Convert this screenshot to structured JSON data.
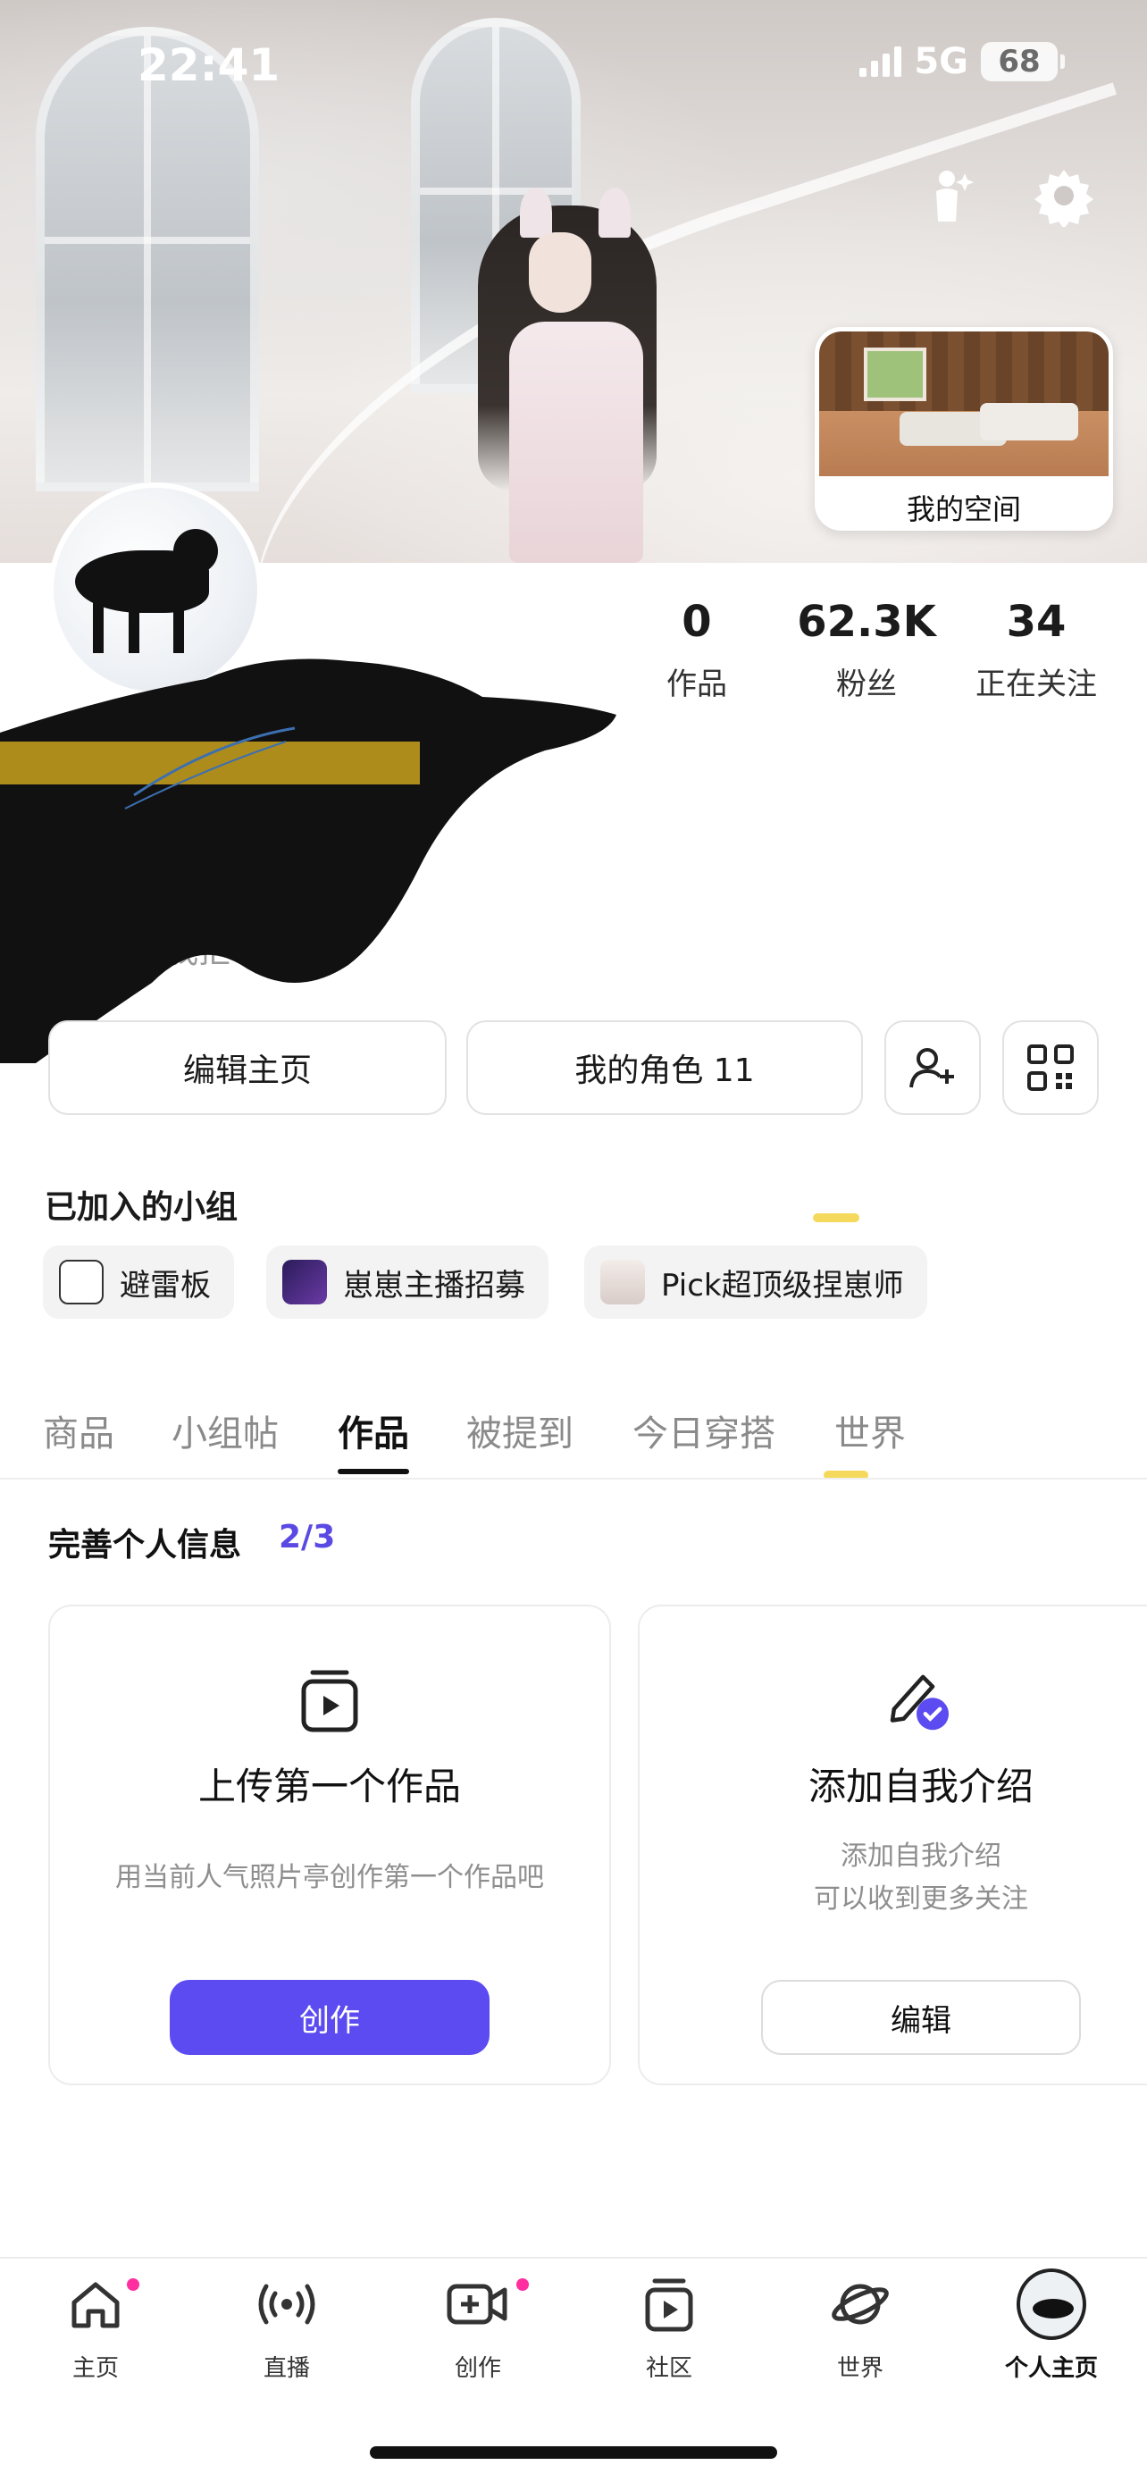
{
  "status_bar": {
    "time": "22:41",
    "network": "5G",
    "battery": "68"
  },
  "header": {
    "my_space_label": "我的空间"
  },
  "stats": [
    {
      "value": "0",
      "label": "作品"
    },
    {
      "value": "62.3K",
      "label": "粉丝"
    },
    {
      "value": "34",
      "label": "正在关注"
    }
  ],
  "bio_fragment": "我拒",
  "actions": {
    "edit_profile": "编辑主页",
    "my_characters": "我的角色 11"
  },
  "groups": {
    "title": "已加入的小组",
    "items": [
      {
        "name": "避雷板"
      },
      {
        "name": "崽崽主播招募"
      },
      {
        "name": "Pick超顶级捏崽师"
      }
    ]
  },
  "tabs": [
    {
      "label": "商品"
    },
    {
      "label": "小组帖"
    },
    {
      "label": "作品"
    },
    {
      "label": "被提到"
    },
    {
      "label": "今日穿搭"
    },
    {
      "label": "世界"
    }
  ],
  "active_tab": "作品",
  "complete_profile": {
    "title": "完善个人信息",
    "progress": "2/3",
    "cards": [
      {
        "icon": "play-card-icon",
        "title": "上传第一个作品",
        "desc_lines": [
          "用当前人气照片亭创作第一个作品吧"
        ],
        "button": "创作"
      },
      {
        "icon": "pencil-check-icon",
        "title": "添加自我介绍",
        "desc_lines": [
          "添加自我介绍",
          "可以收到更多关注"
        ],
        "button": "编辑"
      }
    ]
  },
  "bottom_nav": [
    {
      "label": "主页",
      "icon": "home-icon",
      "dot": true
    },
    {
      "label": "直播",
      "icon": "broadcast-icon",
      "dot": false
    },
    {
      "label": "创作",
      "icon": "video-plus-icon",
      "dot": true
    },
    {
      "label": "社区",
      "icon": "play-card-icon",
      "dot": false
    },
    {
      "label": "世界",
      "icon": "planet-icon",
      "dot": false
    },
    {
      "label": "个人主页",
      "icon": "avatar-icon",
      "dot": false
    }
  ],
  "colors": {
    "accent": "#5b4bf0",
    "dot": "#ff2fa0",
    "highlight": "#f4d54b"
  }
}
